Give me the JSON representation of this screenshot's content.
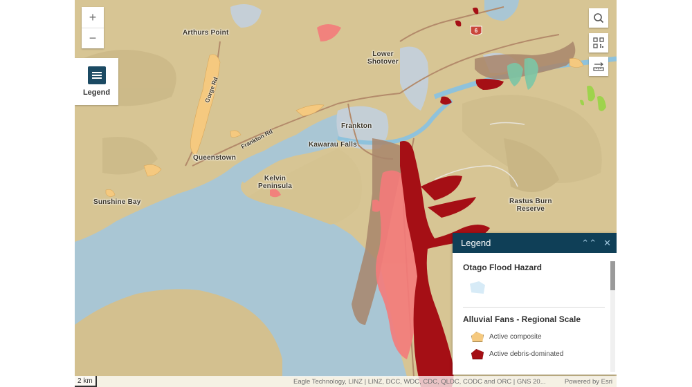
{
  "map": {
    "labels": {
      "arthurs_point": "Arthurs Point",
      "lower_shotover": "Lower\nShotover",
      "frankton": "Frankton",
      "kawarau_falls": "Kawarau Falls",
      "queenstown": "Queenstown",
      "kelvin_peninsula": "Kelvin\nPeninsula",
      "sunshine_bay": "Sunshine Bay",
      "rastus_burn_reserve": "Rastus Burn\nReserve"
    },
    "road_labels": {
      "gorge_rd": "Gorge Rd",
      "frankton_rd": "Frankton Rd"
    },
    "highway_shield": "6",
    "colors": {
      "land": "#d9c795",
      "lake": "#a9c6d4",
      "river": "#8ec2dc",
      "flood_hazard": "#c9d6e2",
      "active_composite": "#f5c97f",
      "active_debris": "#a50f15",
      "inactive_pink": "#f47a7a",
      "brown_fan": "#a8856b",
      "teal_fan": "#7cc6a6",
      "green_fan": "#9ed34c"
    }
  },
  "controls": {
    "zoom_in": "+",
    "zoom_out": "−",
    "legend_button_label": "Legend"
  },
  "legend": {
    "title": "Legend",
    "layers": [
      {
        "title": "Otago Flood Hazard",
        "items": [
          {
            "label": "",
            "color": "#d7ebf7"
          }
        ]
      },
      {
        "title": "Alluvial Fans - Regional Scale",
        "items": [
          {
            "label": "Active composite",
            "color": "#f5c97f"
          },
          {
            "label": "Active debris-dominated",
            "color": "#a50f15"
          }
        ]
      }
    ]
  },
  "footer": {
    "scale": "2 km",
    "attribution": "Eagle Technology, LINZ | LINZ, DCC, WDC, CDC, QLDC, CODC and ORC | GNS 20...",
    "powered_by": "Powered by Esri"
  }
}
